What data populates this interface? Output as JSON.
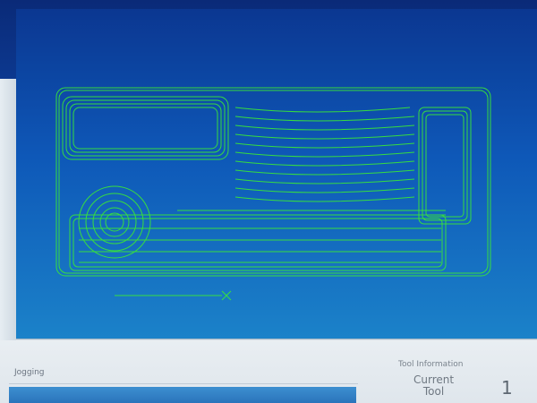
{
  "viewport": {
    "description": "CNC toolpath simulation",
    "toolpath_color": "#39e43a",
    "background": "#0e58b8"
  },
  "jogging": {
    "label": "Jogging"
  },
  "tool_information": {
    "title": "Tool Information",
    "current_label_line1": "Current",
    "current_label_line2": "Tool",
    "current_value": "1"
  }
}
